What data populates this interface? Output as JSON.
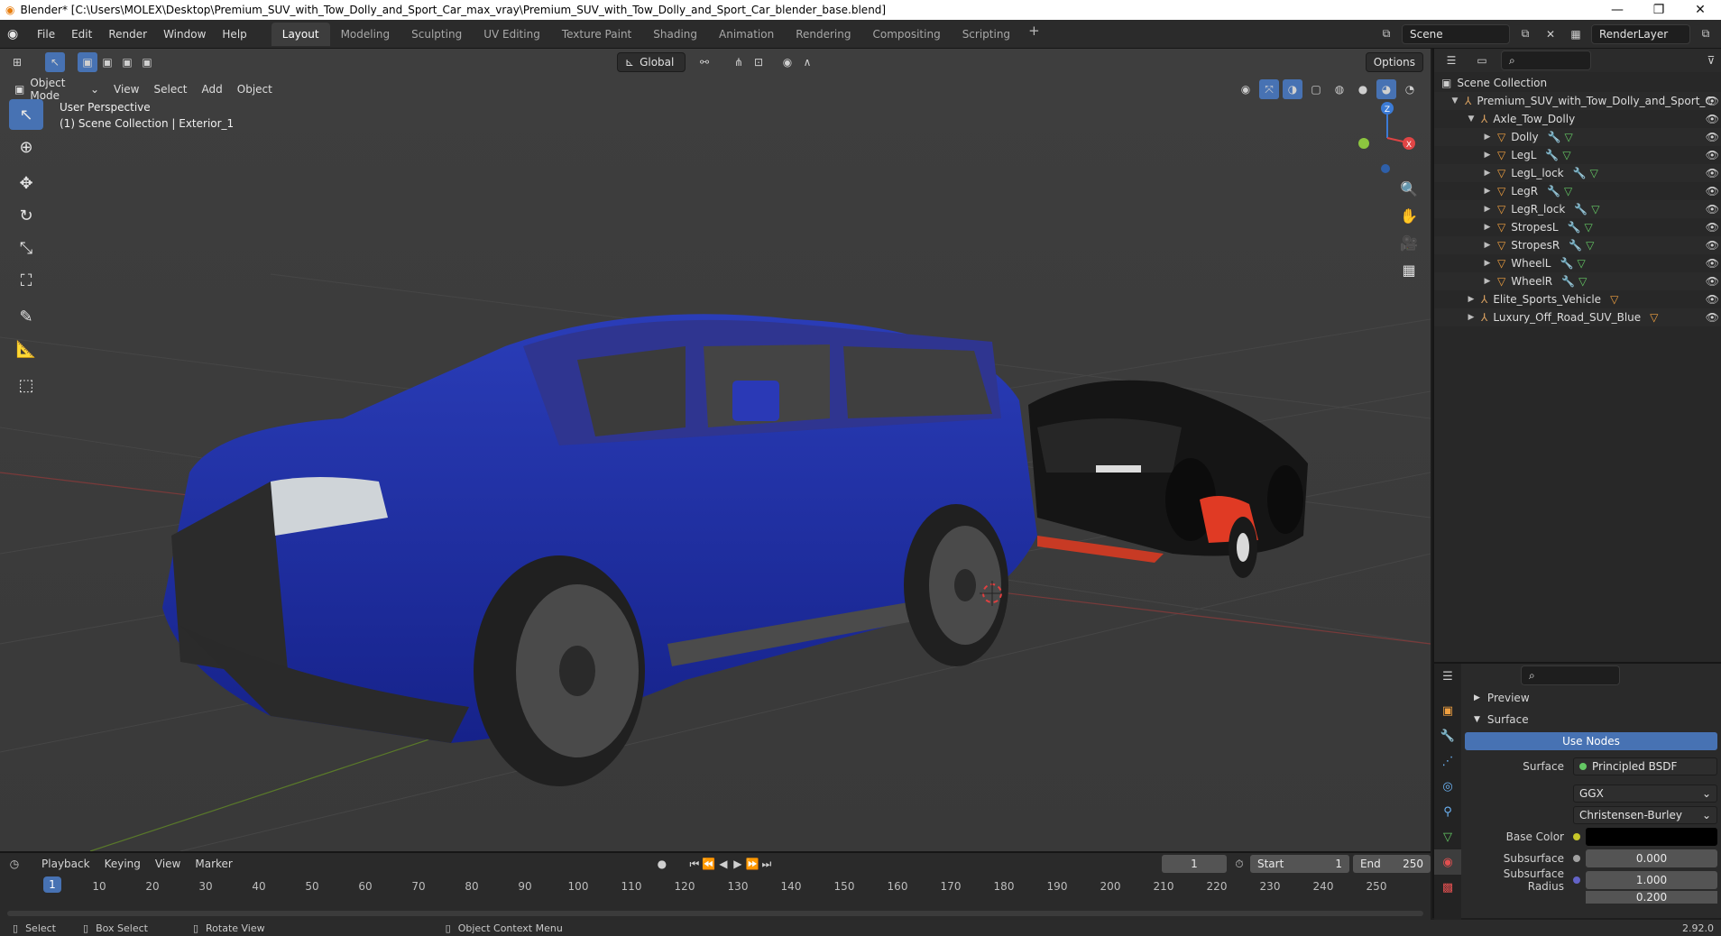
{
  "window": {
    "title": "Blender* [C:\\Users\\MOLEX\\Desktop\\Premium_SUV_with_Tow_Dolly_and_Sport_Car_max_vray\\Premium_SUV_with_Tow_Dolly_and_Sport_Car_blender_base.blend]",
    "controls": [
      "—",
      "❐",
      "✕"
    ]
  },
  "topbar": {
    "menus": [
      "File",
      "Edit",
      "Render",
      "Window",
      "Help"
    ],
    "workspaces": [
      "Layout",
      "Modeling",
      "Sculpting",
      "UV Editing",
      "Texture Paint",
      "Shading",
      "Animation",
      "Rendering",
      "Compositing",
      "Scripting"
    ],
    "active_workspace": "Layout",
    "scene": "Scene",
    "render_layer": "RenderLayer"
  },
  "viewport": {
    "mode": "Object Mode",
    "menus": [
      "View",
      "Select",
      "Add",
      "Object"
    ],
    "orientation": "Global",
    "options_label": "Options",
    "perspective": "User Perspective",
    "collection_info": "(1) Scene Collection | Exterior_1"
  },
  "outliner": {
    "root": "Scene Collection",
    "items": [
      {
        "name": "Premium_SUV_with_Tow_Dolly_and_Sport_C",
        "indent": 0
      },
      {
        "name": "Axle_Tow_Dolly",
        "indent": 1
      },
      {
        "name": "Dolly",
        "indent": 2
      },
      {
        "name": "LegL",
        "indent": 2
      },
      {
        "name": "LegL_lock",
        "indent": 2
      },
      {
        "name": "LegR",
        "indent": 2
      },
      {
        "name": "LegR_lock",
        "indent": 2
      },
      {
        "name": "StropesL",
        "indent": 2
      },
      {
        "name": "StropesR",
        "indent": 2
      },
      {
        "name": "WheelL",
        "indent": 2
      },
      {
        "name": "WheelR",
        "indent": 2
      },
      {
        "name": "Elite_Sports_Vehicle",
        "indent": 1
      },
      {
        "name": "Luxury_Off_Road_SUV_Blue",
        "indent": 1
      }
    ]
  },
  "properties": {
    "sections": [
      "Preview",
      "Surface"
    ],
    "use_nodes": "Use Nodes",
    "surface_label": "Surface",
    "surface_value": "Principled BSDF",
    "distribution": "GGX",
    "subsurface_method": "Christensen-Burley",
    "base_color_label": "Base Color",
    "subsurface_label": "Subsurface",
    "subsurface_value": "0.000",
    "subsurface_radius_label": "Subsurface Radius",
    "subsurface_radius_1": "1.000",
    "subsurface_radius_2": "0.200"
  },
  "timeline": {
    "menus": [
      "Playback",
      "Keying",
      "View",
      "Marker"
    ],
    "current_frame": "1",
    "start_label": "Start",
    "start": "1",
    "end_label": "End",
    "end": "250",
    "ticks": [
      "10",
      "20",
      "30",
      "40",
      "50",
      "60",
      "70",
      "80",
      "90",
      "100",
      "110",
      "120",
      "130",
      "140",
      "150",
      "160",
      "170",
      "180",
      "190",
      "200",
      "210",
      "220",
      "230",
      "240",
      "250"
    ]
  },
  "statusbar": {
    "select": "Select",
    "box_select": "Box Select",
    "rotate": "Rotate View",
    "context": "Object Context Menu",
    "version": "2.92.0"
  }
}
